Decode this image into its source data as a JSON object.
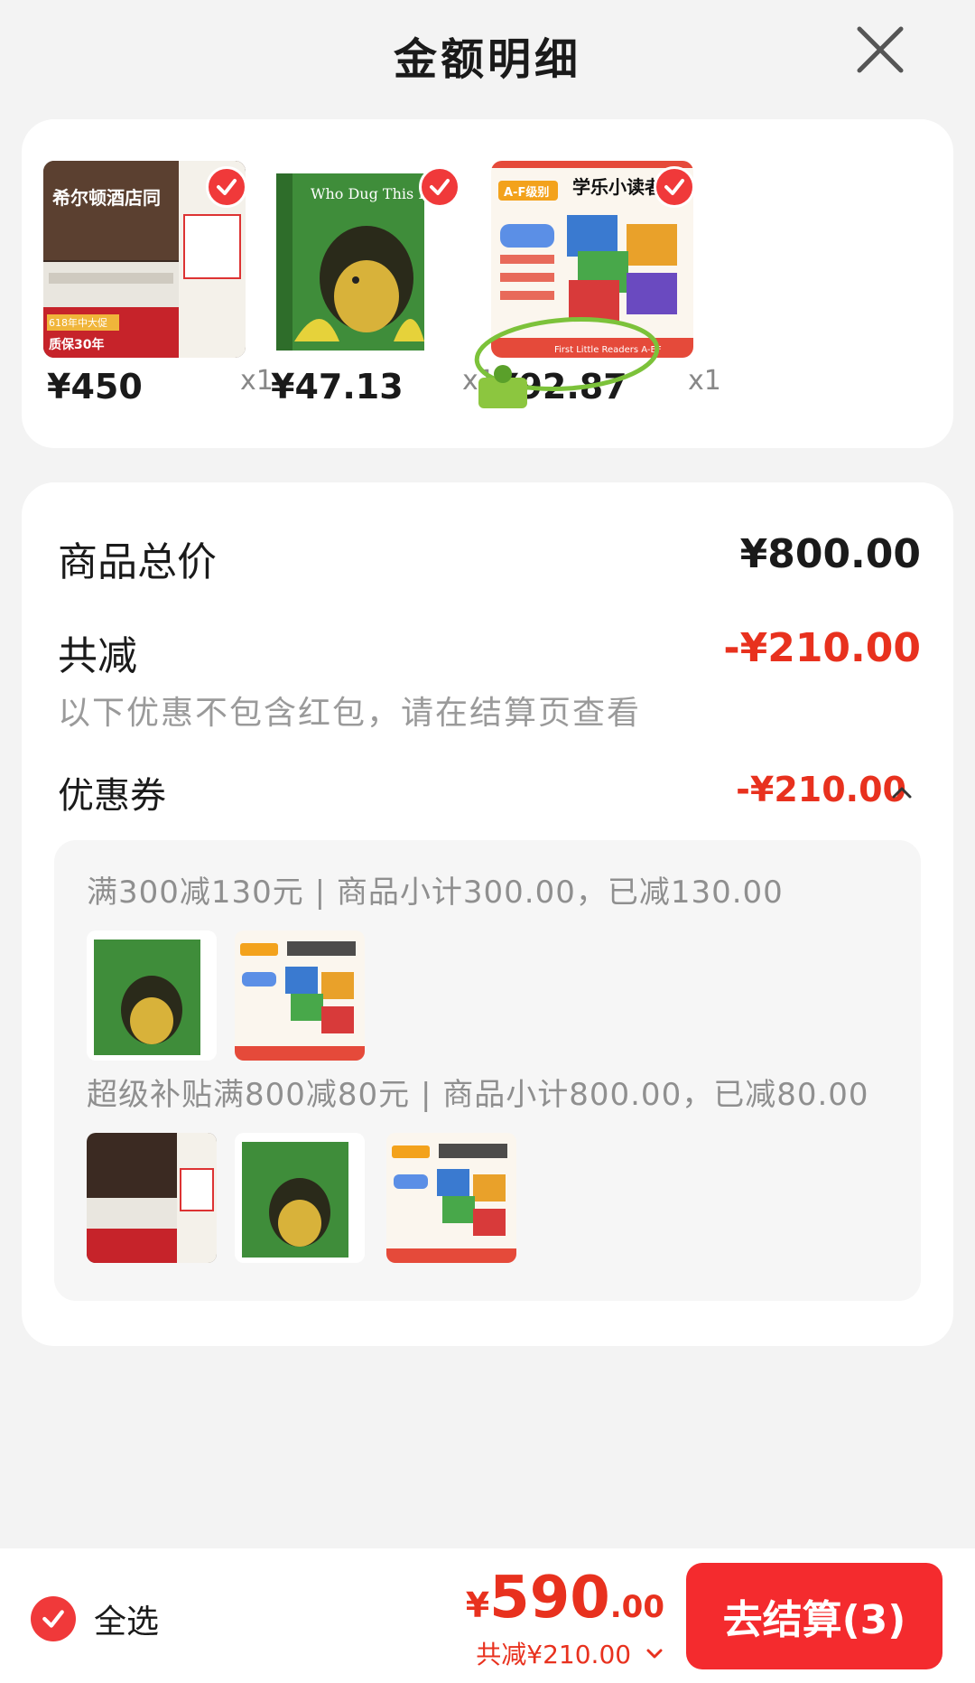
{
  "header": {
    "title": "金额明细"
  },
  "products": [
    {
      "price": "¥450",
      "qty": "x1",
      "image": "mattress-image",
      "text1": "希尔顿酒店同",
      "text2": "质保30年",
      "text3": "618年中大促"
    },
    {
      "price": "¥47.13",
      "qty": "x1",
      "image": "book-who-dug-this-hole",
      "cover_title": "Who Dug This HOLE?"
    },
    {
      "price": "¥92.87",
      "qty": "x1",
      "image": "book-set-xuele",
      "set_title": "学乐小读者",
      "set_badge": "A-F级别",
      "set_sub": "First Little Readers A-EF"
    }
  ],
  "summary": {
    "total_label": "商品总价",
    "total_value": "¥800.00",
    "discount_label": "共减",
    "discount_value": "-¥210.00",
    "hint": "以下优惠不包含红包，请在结算页查看",
    "coupon_label": "优惠券",
    "coupon_value": "-¥210.00"
  },
  "coupons": [
    {
      "rule": "满300减130元 | 商品小计300.00，已减130.00",
      "items": [
        "book-who-dug-this-hole",
        "book-set-xuele"
      ]
    },
    {
      "rule": "超级补贴满800减80元 | 商品小计800.00，已减80.00",
      "items": [
        "mattress-image",
        "book-who-dug-this-hole",
        "book-set-xuele"
      ]
    }
  ],
  "bottom": {
    "select_all": "全选",
    "currency": "¥",
    "amount_int": "590",
    "amount_dec": ".00",
    "saved": "共减¥210.00",
    "checkout": "去结算(3)"
  },
  "colors": {
    "accent_red": "#e8311e",
    "button_red": "#f42b2e",
    "check_red": "#f0393a"
  }
}
